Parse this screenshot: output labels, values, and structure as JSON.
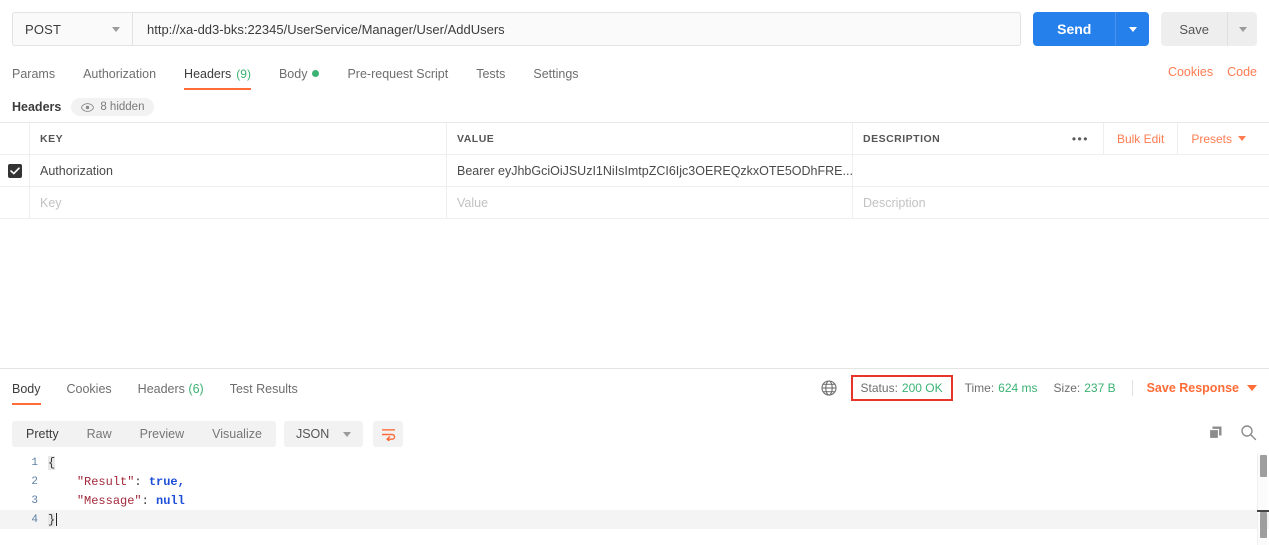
{
  "request": {
    "method": "POST",
    "url": "http://xa-dd3-bks:22345/UserService/Manager/User/AddUsers",
    "send_label": "Send",
    "save_label": "Save",
    "tabs": [
      {
        "label": "Params",
        "count": "",
        "dot": false,
        "active": false
      },
      {
        "label": "Authorization",
        "count": "",
        "dot": false,
        "active": false
      },
      {
        "label": "Headers",
        "count": "(9)",
        "dot": false,
        "active": true
      },
      {
        "label": "Body",
        "count": "",
        "dot": true,
        "active": false
      },
      {
        "label": "Pre-request Script",
        "count": "",
        "dot": false,
        "active": false
      },
      {
        "label": "Tests",
        "count": "",
        "dot": false,
        "active": false
      },
      {
        "label": "Settings",
        "count": "",
        "dot": false,
        "active": false
      }
    ],
    "cookies_link": "Cookies",
    "code_link": "Code",
    "headers_section_label": "Headers",
    "hidden_pill": "8 hidden",
    "table": {
      "columns": {
        "key": "KEY",
        "value": "VALUE",
        "description": "DESCRIPTION"
      },
      "actions": {
        "more": "•••",
        "bulk_edit": "Bulk Edit",
        "presets": "Presets"
      },
      "rows": [
        {
          "checked": true,
          "key": "Authorization",
          "value": "Bearer eyJhbGciOiJSUzI1NiIsImtpZCI6Ijc3OEREQzkxOTE5ODhFRE...",
          "description": ""
        }
      ],
      "placeholder_row": {
        "key": "Key",
        "value": "Value",
        "description": "Description"
      }
    }
  },
  "response": {
    "tabs": [
      {
        "label": "Body",
        "count": "",
        "active": true
      },
      {
        "label": "Cookies",
        "count": "",
        "active": false
      },
      {
        "label": "Headers",
        "count": "(6)",
        "active": false
      },
      {
        "label": "Test Results",
        "count": "",
        "active": false
      }
    ],
    "status_label": "Status:",
    "status_value": "200 OK",
    "time_label": "Time:",
    "time_value": "624 ms",
    "size_label": "Size:",
    "size_value": "237 B",
    "save_response": "Save Response",
    "format_tabs": [
      {
        "label": "Pretty",
        "active": true
      },
      {
        "label": "Raw",
        "active": false
      },
      {
        "label": "Preview",
        "active": false
      },
      {
        "label": "Visualize",
        "active": false
      }
    ],
    "language": "JSON",
    "body_lines": [
      {
        "no": "1",
        "indent": "",
        "raw": "{"
      },
      {
        "no": "2",
        "indent": "    ",
        "key": "\"Result\"",
        "sep": ": ",
        "val": "true",
        "tail": ","
      },
      {
        "no": "3",
        "indent": "    ",
        "key": "\"Message\"",
        "sep": ": ",
        "val": "null",
        "tail": ""
      },
      {
        "no": "4",
        "indent": "",
        "raw": "}"
      }
    ]
  },
  "colors": {
    "accent": "#ff6c37",
    "send_blue": "#2680eb",
    "green": "#3bb273",
    "status_box_red": "#e8342a"
  }
}
